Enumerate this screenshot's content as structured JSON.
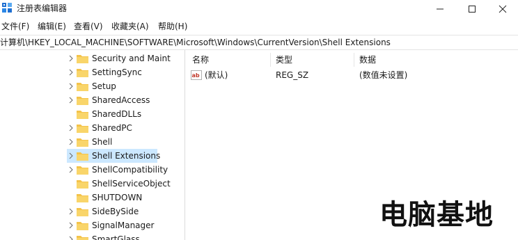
{
  "window": {
    "title": "注册表编辑器"
  },
  "menu": [
    {
      "label": "文件(F)"
    },
    {
      "label": "编辑(E)"
    },
    {
      "label": "查看(V)"
    },
    {
      "label": "收藏夹(A)"
    },
    {
      "label": "帮助(H)"
    }
  ],
  "address": {
    "path": "计算机\\HKEY_LOCAL_MACHINE\\SOFTWARE\\Microsoft\\Windows\\CurrentVersion\\Shell Extensions"
  },
  "tree": {
    "items": [
      {
        "label": "Security and Mainte"
      },
      {
        "label": "SettingSync"
      },
      {
        "label": "Setup"
      },
      {
        "label": "SharedAccess"
      },
      {
        "label": "SharedDLLs"
      },
      {
        "label": "SharedPC"
      },
      {
        "label": "Shell"
      },
      {
        "label": "Shell Extensions",
        "selected": true
      },
      {
        "label": "ShellCompatibility"
      },
      {
        "label": "ShellServiceObjectD"
      },
      {
        "label": "SHUTDOWN"
      },
      {
        "label": "SideBySide"
      },
      {
        "label": "SignalManager"
      },
      {
        "label": "SmartGlass"
      }
    ]
  },
  "values": {
    "columns": [
      "名称",
      "类型",
      "数据"
    ],
    "rows": [
      {
        "name": "(默认)",
        "type": "REG_SZ",
        "data": "(数值未设置)",
        "icon": "string-value-icon"
      }
    ]
  },
  "watermark": {
    "text": "电脑基地"
  },
  "colors": {
    "selection": "#cce8ff",
    "folder": "#f4c34a",
    "app_icon": "#1f6fd1"
  }
}
